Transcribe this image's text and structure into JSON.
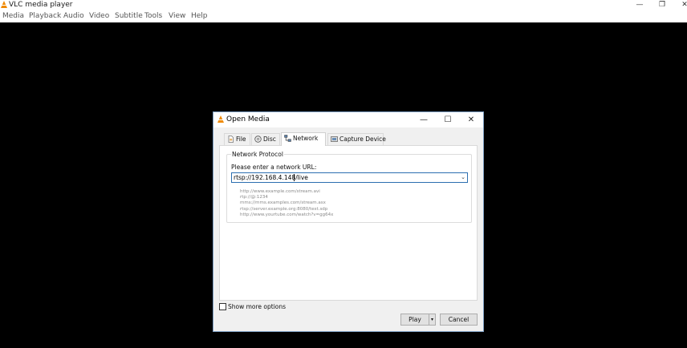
{
  "window": {
    "title": "VLC media player",
    "controls": {
      "minimize": "—",
      "restore": "❐",
      "close": "✕"
    }
  },
  "menu": [
    "Media",
    "Playback",
    "Audio",
    "Video",
    "Subtitle",
    "Tools",
    "View",
    "Help"
  ],
  "dialog": {
    "title": "Open Media",
    "controls": {
      "minimize": "—",
      "maximize": "☐",
      "close": "✕"
    },
    "tabs": [
      {
        "label": "File",
        "icon": "file-icon"
      },
      {
        "label": "Disc",
        "icon": "disc-icon"
      },
      {
        "label": "Network",
        "icon": "network-icon",
        "active": true
      },
      {
        "label": "Capture Device",
        "icon": "capture-device-icon"
      }
    ],
    "network": {
      "group_label": "Network Protocol",
      "url_label": "Please enter a network URL:",
      "url_value": "rtsp://192.168.4.148/live",
      "examples": [
        "http://www.example.com/stream.avi",
        "rtp://@:1234",
        "mms://mms.examples.com/stream.asx",
        "rtsp://server.example.org:8080/test.sdp",
        "http://www.yourtube.com/watch?v=gg64x"
      ]
    },
    "show_more_options": {
      "label": "Show more options",
      "checked": false
    },
    "buttons": {
      "play": "Play",
      "play_dropdown": "▾",
      "cancel": "Cancel"
    }
  },
  "colors": {
    "vlc_orange": "#f08a00",
    "focus_blue": "#2c6fb0",
    "video_bg": "#000000"
  }
}
